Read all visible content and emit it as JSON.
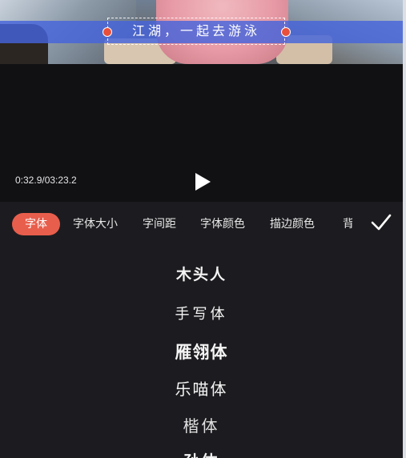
{
  "video": {
    "caption_text": "江湖，一起去游泳"
  },
  "player": {
    "timecode": "0:32.9/03:23.2",
    "play_icon": "play-icon"
  },
  "tabs": [
    {
      "label": "字体",
      "active": true
    },
    {
      "label": "字体大小",
      "active": false
    },
    {
      "label": "字间距",
      "active": false
    },
    {
      "label": "字体颜色",
      "active": false
    },
    {
      "label": "描边颜色",
      "active": false
    },
    {
      "label": "背",
      "active": false
    }
  ],
  "confirm_icon": "checkmark-icon",
  "fonts": [
    {
      "label": "木头人"
    },
    {
      "label": "手写体"
    },
    {
      "label": "雁翎体"
    },
    {
      "label": "乐喵体"
    },
    {
      "label": "楷体"
    },
    {
      "label": "孙体"
    }
  ],
  "colors": {
    "accent": "#e85e4c",
    "panel_bg": "#1c1c20",
    "player_bg": "#111114",
    "caption_band": "#4664dc"
  }
}
